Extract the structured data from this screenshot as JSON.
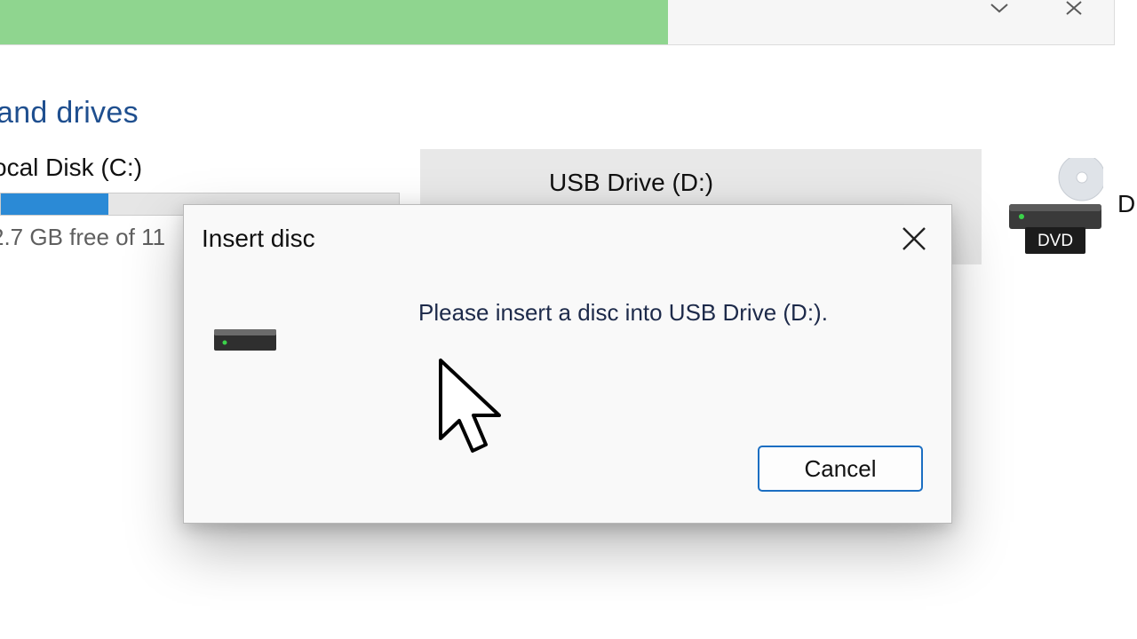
{
  "window": {
    "copy_progress": 0.6,
    "progress_color": "#8fd58f",
    "dropdown_icon": "chevron-down-icon",
    "close_icon": "close-icon"
  },
  "section": {
    "title": "and drives"
  },
  "drives": [
    {
      "name": "ocal Disk (C:)",
      "free_text": "2.7 GB free of 11",
      "usage_fraction": 0.27,
      "bar_color": "#2b8ad6"
    },
    {
      "name": "USB Drive (D:)"
    },
    {
      "name": "D",
      "badge": "DVD"
    }
  ],
  "dialog": {
    "title": "Insert disc",
    "message": "Please insert a disc into USB Drive (D:).",
    "cancel_label": "Cancel",
    "accent": "#1b6ec2",
    "close_icon": "close-icon",
    "drive_icon": "removable-drive-icon"
  },
  "pointer": {
    "icon": "mouse-cursor-icon"
  }
}
